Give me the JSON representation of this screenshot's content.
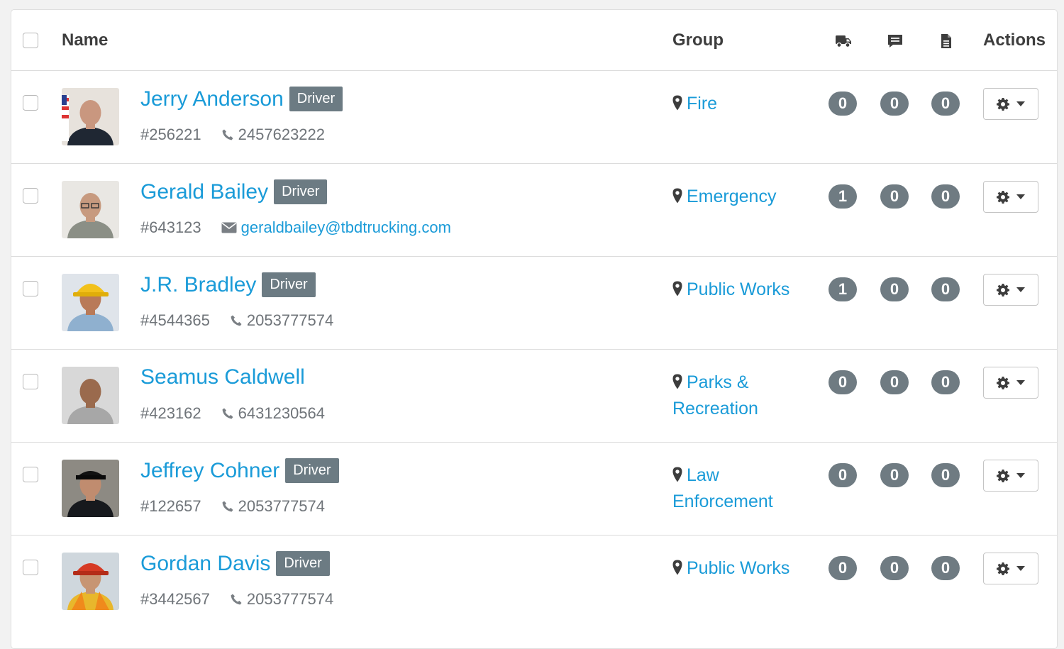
{
  "header": {
    "name_label": "Name",
    "group_label": "Group",
    "actions_label": "Actions",
    "icons": [
      "truck-icon",
      "comment-icon",
      "file-icon"
    ]
  },
  "colors": {
    "link": "#1a9bd8",
    "badge": "#6c7b83",
    "count": "#6f7b82"
  },
  "drivers": [
    {
      "name": "Jerry Anderson",
      "badge": "Driver",
      "id": "#256221",
      "contact_type": "phone",
      "contact": "2457623222",
      "group": "Fire",
      "counts": [
        "0",
        "0",
        "0"
      ]
    },
    {
      "name": "Gerald Bailey",
      "badge": "Driver",
      "id": "#643123",
      "contact_type": "email",
      "contact": "geraldbailey@tbdtrucking.com",
      "group": "Emergency",
      "counts": [
        "1",
        "0",
        "0"
      ]
    },
    {
      "name": "J.R. Bradley",
      "badge": "Driver",
      "id": "#4544365",
      "contact_type": "phone",
      "contact": "2053777574",
      "group": "Public Works",
      "counts": [
        "1",
        "0",
        "0"
      ]
    },
    {
      "name": "Seamus Caldwell",
      "badge": "",
      "id": "#423162",
      "contact_type": "phone",
      "contact": "6431230564",
      "group": "Parks & Recreation",
      "counts": [
        "0",
        "0",
        "0"
      ]
    },
    {
      "name": "Jeffrey Cohner",
      "badge": "Driver",
      "id": "#122657",
      "contact_type": "phone",
      "contact": "2053777574",
      "group": "Law Enforcement",
      "counts": [
        "0",
        "0",
        "0"
      ]
    },
    {
      "name": "Gordan Davis",
      "badge": "Driver",
      "id": "#3442567",
      "contact_type": "phone",
      "contact": "2053777574",
      "group": "Public Works",
      "counts": [
        "0",
        "0",
        "0"
      ]
    }
  ]
}
